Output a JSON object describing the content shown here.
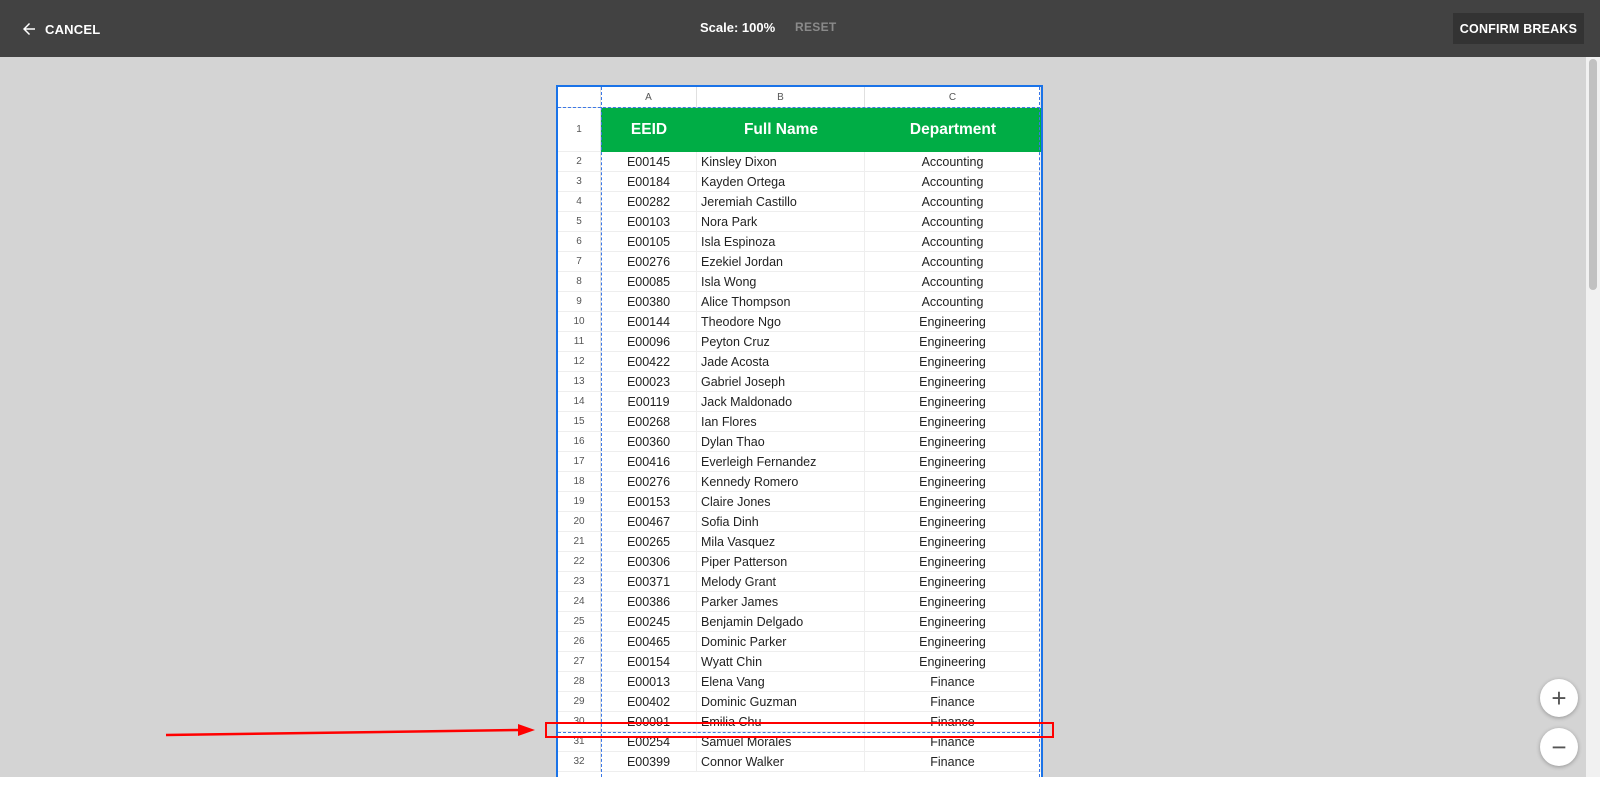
{
  "toolbar": {
    "cancel_label": "CANCEL",
    "scale_label": "Scale: 100%",
    "reset_label": "RESET",
    "confirm_label": "CONFIRM BREAKS"
  },
  "columns": [
    "A",
    "B",
    "C"
  ],
  "headers": {
    "eeid": "EEID",
    "full_name": "Full Name",
    "department": "Department",
    "row_num": "1"
  },
  "rows": [
    {
      "n": "2",
      "id": "E00145",
      "name": "Kinsley Dixon",
      "dept": "Accounting"
    },
    {
      "n": "3",
      "id": "E00184",
      "name": "Kayden Ortega",
      "dept": "Accounting"
    },
    {
      "n": "4",
      "id": "E00282",
      "name": "Jeremiah Castillo",
      "dept": "Accounting"
    },
    {
      "n": "5",
      "id": "E00103",
      "name": "Nora Park",
      "dept": "Accounting"
    },
    {
      "n": "6",
      "id": "E00105",
      "name": "Isla Espinoza",
      "dept": "Accounting"
    },
    {
      "n": "7",
      "id": "E00276",
      "name": "Ezekiel Jordan",
      "dept": "Accounting"
    },
    {
      "n": "8",
      "id": "E00085",
      "name": "Isla Wong",
      "dept": "Accounting"
    },
    {
      "n": "9",
      "id": "E00380",
      "name": "Alice Thompson",
      "dept": "Accounting"
    },
    {
      "n": "10",
      "id": "E00144",
      "name": "Theodore Ngo",
      "dept": "Engineering"
    },
    {
      "n": "11",
      "id": "E00096",
      "name": "Peyton Cruz",
      "dept": "Engineering"
    },
    {
      "n": "12",
      "id": "E00422",
      "name": "Jade Acosta",
      "dept": "Engineering"
    },
    {
      "n": "13",
      "id": "E00023",
      "name": "Gabriel Joseph",
      "dept": "Engineering"
    },
    {
      "n": "14",
      "id": "E00119",
      "name": "Jack Maldonado",
      "dept": "Engineering"
    },
    {
      "n": "15",
      "id": "E00268",
      "name": "Ian Flores",
      "dept": "Engineering"
    },
    {
      "n": "16",
      "id": "E00360",
      "name": "Dylan Thao",
      "dept": "Engineering"
    },
    {
      "n": "17",
      "id": "E00416",
      "name": "Everleigh Fernandez",
      "dept": "Engineering"
    },
    {
      "n": "18",
      "id": "E00276",
      "name": "Kennedy Romero",
      "dept": "Engineering"
    },
    {
      "n": "19",
      "id": "E00153",
      "name": "Claire Jones",
      "dept": "Engineering"
    },
    {
      "n": "20",
      "id": "E00467",
      "name": "Sofia Dinh",
      "dept": "Engineering"
    },
    {
      "n": "21",
      "id": "E00265",
      "name": "Mila Vasquez",
      "dept": "Engineering"
    },
    {
      "n": "22",
      "id": "E00306",
      "name": "Piper Patterson",
      "dept": "Engineering"
    },
    {
      "n": "23",
      "id": "E00371",
      "name": "Melody Grant",
      "dept": "Engineering"
    },
    {
      "n": "24",
      "id": "E00386",
      "name": "Parker James",
      "dept": "Engineering"
    },
    {
      "n": "25",
      "id": "E00245",
      "name": "Benjamin Delgado",
      "dept": "Engineering"
    },
    {
      "n": "26",
      "id": "E00465",
      "name": "Dominic Parker",
      "dept": "Engineering"
    },
    {
      "n": "27",
      "id": "E00154",
      "name": "Wyatt Chin",
      "dept": "Engineering"
    },
    {
      "n": "28",
      "id": "E00013",
      "name": "Elena Vang",
      "dept": "Finance"
    },
    {
      "n": "29",
      "id": "E00402",
      "name": "Dominic Guzman",
      "dept": "Finance"
    },
    {
      "n": "30",
      "id": "E00091",
      "name": "Emilia Chu",
      "dept": "Finance"
    },
    {
      "n": "31",
      "id": "E00254",
      "name": "Samuel Morales",
      "dept": "Finance"
    },
    {
      "n": "32",
      "id": "E00399",
      "name": "Connor Walker",
      "dept": "Finance"
    }
  ],
  "zoom": {
    "in_label": "+",
    "out_label": "−"
  },
  "colors": {
    "header_green": "#00ad45",
    "break_line": "#3b78e7",
    "annotation": "#ff0000",
    "toolbar": "#424242"
  }
}
